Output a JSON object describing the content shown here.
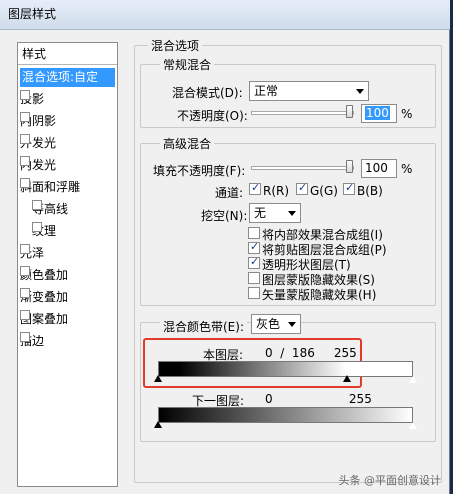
{
  "window": {
    "title": "图层样式"
  },
  "styles_panel": {
    "header": "样式",
    "items": [
      {
        "label": "混合选项:自定",
        "selected": true,
        "checkbox": false
      },
      {
        "label": "投影",
        "checkbox": true
      },
      {
        "label": "内阴影",
        "checkbox": true
      },
      {
        "label": "外发光",
        "checkbox": true
      },
      {
        "label": "内发光",
        "checkbox": true
      },
      {
        "label": "斜面和浮雕",
        "checkbox": true
      },
      {
        "label": "等高线",
        "checkbox": true,
        "indent": true
      },
      {
        "label": "纹理",
        "checkbox": true,
        "indent": true
      },
      {
        "label": "光泽",
        "checkbox": true
      },
      {
        "label": "颜色叠加",
        "checkbox": true
      },
      {
        "label": "渐变叠加",
        "checkbox": true
      },
      {
        "label": "图案叠加",
        "checkbox": true
      },
      {
        "label": "描边",
        "checkbox": true
      }
    ]
  },
  "blend_options": {
    "title": "混合选项",
    "general": {
      "title": "常规混合",
      "mode_label": "混合模式(D):",
      "mode_value": "正常",
      "opacity_label": "不透明度(O):",
      "opacity_value": "100",
      "opacity_unit": "%"
    },
    "advanced": {
      "title": "高级混合",
      "fill_label": "填充不透明度(F):",
      "fill_value": "100",
      "fill_unit": "%",
      "channels_label": "通道:",
      "channels": [
        {
          "label": "R(R)",
          "checked": true
        },
        {
          "label": "G(G)",
          "checked": true
        },
        {
          "label": "B(B)",
          "checked": true
        }
      ],
      "knockout_label": "挖空(N):",
      "knockout_value": "无",
      "options": [
        {
          "label": "将内部效果混合成组(I)",
          "checked": false
        },
        {
          "label": "将剪贴图层混合成组(P)",
          "checked": true
        },
        {
          "label": "透明形状图层(T)",
          "checked": true
        },
        {
          "label": "图层蒙版隐藏效果(S)",
          "checked": false
        },
        {
          "label": "矢量蒙版隐藏效果(H)",
          "checked": false
        }
      ]
    },
    "blend_if": {
      "label": "混合颜色带(E):",
      "value": "灰色",
      "this_layer_label": "本图层:",
      "this_layer_values": "0  /  186     255",
      "underlying_label": "下一图层:",
      "underlying_values": "0                    255"
    }
  },
  "watermark": "头条 @平面创意设计"
}
